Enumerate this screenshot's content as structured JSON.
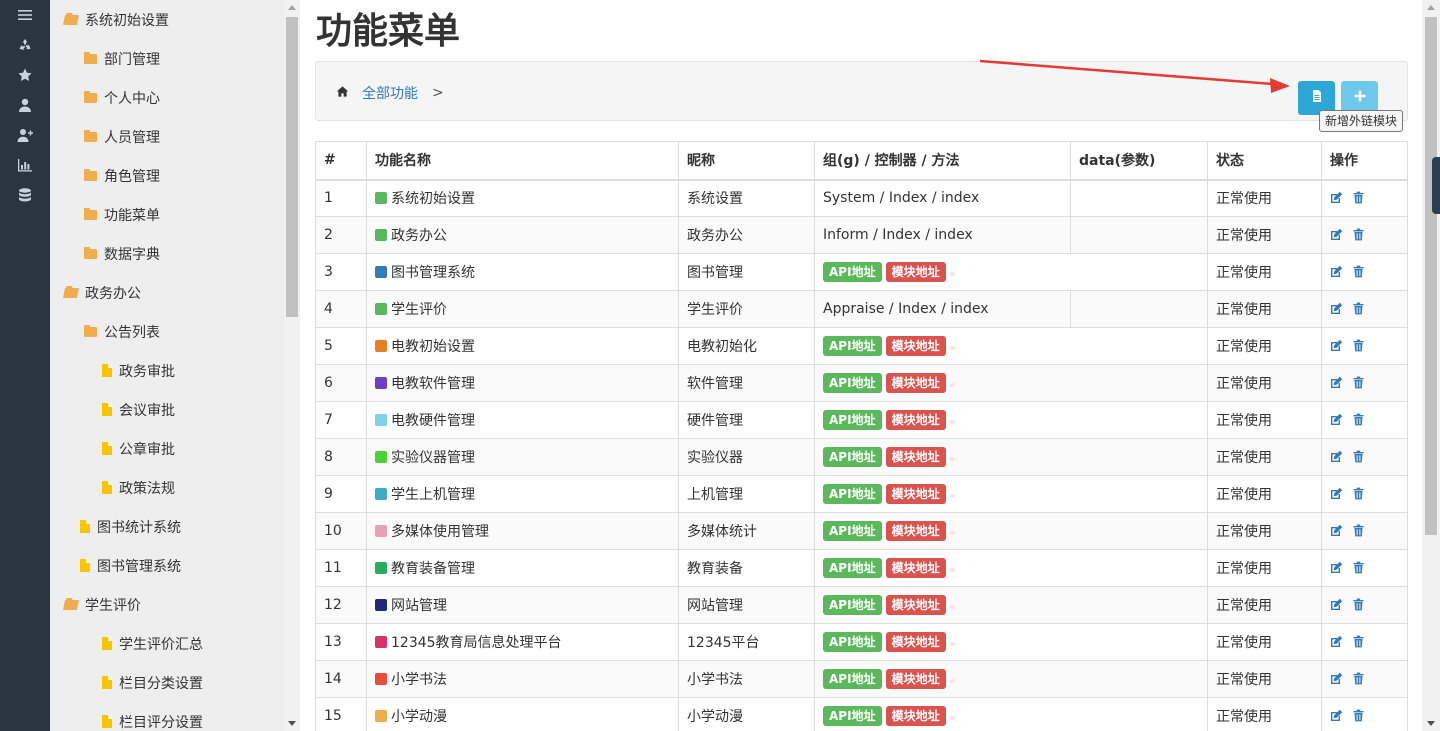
{
  "rail_icons": [
    "menu-icon",
    "recycle-icon",
    "star-icon",
    "user-icon",
    "add-user-icon",
    "bar-chart-icon",
    "database-icon"
  ],
  "tree": [
    {
      "label": "系统初始设置",
      "icon": "folder-open",
      "level": 0
    },
    {
      "label": "部门管理",
      "icon": "folder",
      "level": 1
    },
    {
      "label": "个人中心",
      "icon": "folder",
      "level": 1
    },
    {
      "label": "人员管理",
      "icon": "folder",
      "level": 1
    },
    {
      "label": "角色管理",
      "icon": "folder",
      "level": 1
    },
    {
      "label": "功能菜单",
      "icon": "folder",
      "level": 1
    },
    {
      "label": "数据字典",
      "icon": "folder",
      "level": 1
    },
    {
      "label": "政务办公",
      "icon": "folder-open",
      "level": 0
    },
    {
      "label": "公告列表",
      "icon": "folder",
      "level": 1
    },
    {
      "label": "政务审批",
      "icon": "file",
      "level": 2
    },
    {
      "label": "会议审批",
      "icon": "file",
      "level": 2
    },
    {
      "label": "公章审批",
      "icon": "file",
      "level": 2
    },
    {
      "label": "政策法规",
      "icon": "file",
      "level": 2
    },
    {
      "label": "图书统计系统",
      "icon": "file",
      "level": 1
    },
    {
      "label": "图书管理系统",
      "icon": "file",
      "level": 1
    },
    {
      "label": "学生评价",
      "icon": "folder-open",
      "level": 0
    },
    {
      "label": "学生评价汇总",
      "icon": "file",
      "level": 2
    },
    {
      "label": "栏目分类设置",
      "icon": "file",
      "level": 2
    },
    {
      "label": "栏目评分设置",
      "icon": "file",
      "level": 2
    }
  ],
  "page_title": "功能菜单",
  "breadcrumb": {
    "root": "全部功能",
    "separator": ">"
  },
  "toolbar": {
    "tooltip": "新增外链模块",
    "add_link_icon": "file-text-icon",
    "add_icon": "plus-icon"
  },
  "table": {
    "headers": [
      "#",
      "功能名称",
      "昵称",
      "组(g) / 控制器 / 方法",
      "data(参数)",
      "状态",
      "操作"
    ],
    "api_label": "API地址",
    "module_label": "模块地址",
    "rows": [
      {
        "num": "1",
        "name": "系统初始设置",
        "nick": "系统设置",
        "route": "System / Index / index",
        "status": "正常使用",
        "icon_color": "#5cb85c",
        "icon": "refresh-icon"
      },
      {
        "num": "2",
        "name": "政务办公",
        "nick": "政务办公",
        "route": "Inform / Index / index",
        "status": "正常使用",
        "icon_color": "#5cb85c",
        "icon": "bullhorn-icon"
      },
      {
        "num": "3",
        "name": "图书管理系统",
        "nick": "图书管理",
        "route": "",
        "status": "正常使用",
        "icon_color": "#337ab7",
        "icon": "book-icon"
      },
      {
        "num": "4",
        "name": "学生评价",
        "nick": "学生评价",
        "route": "Appraise / Index / index",
        "status": "正常使用",
        "icon_color": "#5cb85c",
        "icon": "edit-icon"
      },
      {
        "num": "5",
        "name": "电教初始设置",
        "nick": "电教初始化",
        "route": "",
        "status": "正常使用",
        "icon_color": "#e67e22",
        "icon": "clock-icon"
      },
      {
        "num": "6",
        "name": "电教软件管理",
        "nick": "软件管理",
        "route": "",
        "status": "正常使用",
        "icon_color": "#6c3fc5",
        "icon": "pencil-icon"
      },
      {
        "num": "7",
        "name": "电教硬件管理",
        "nick": "硬件管理",
        "route": "",
        "status": "正常使用",
        "icon_color": "#7fd3e8",
        "icon": "gears-icon"
      },
      {
        "num": "8",
        "name": "实验仪器管理",
        "nick": "实验仪器",
        "route": "",
        "status": "正常使用",
        "icon_color": "#4cd137",
        "icon": "glass-icon"
      },
      {
        "num": "9",
        "name": "学生上机管理",
        "nick": "上机管理",
        "route": "",
        "status": "正常使用",
        "icon_color": "#3fa9c9",
        "icon": "laptop-icon"
      },
      {
        "num": "10",
        "name": "多媒体使用管理",
        "nick": "多媒体统计",
        "route": "",
        "status": "正常使用",
        "icon_color": "#e8a0b4",
        "icon": "picture-icon"
      },
      {
        "num": "11",
        "name": "教育装备管理",
        "nick": "教育装备",
        "route": "",
        "status": "正常使用",
        "icon_color": "#27ae60",
        "icon": "briefcase-icon"
      },
      {
        "num": "12",
        "name": "网站管理",
        "nick": "网站管理",
        "route": "",
        "status": "正常使用",
        "icon_color": "#1e2a78",
        "icon": "desktop-icon"
      },
      {
        "num": "13",
        "name": "12345教育局信息处理平台",
        "nick": "12345平台",
        "route": "",
        "status": "正常使用",
        "icon_color": "#d6336c",
        "icon": "picture-icon"
      },
      {
        "num": "14",
        "name": "小学书法",
        "nick": "小学书法",
        "route": "",
        "status": "正常使用",
        "icon_color": "#e74c3c",
        "icon": "brush-icon"
      },
      {
        "num": "15",
        "name": "小学动漫",
        "nick": "小学动漫",
        "route": "",
        "status": "正常使用",
        "icon_color": "#f0ad4e",
        "icon": "cube-icon"
      }
    ]
  },
  "colors": {
    "rail_bg": "#2a3542",
    "sidebar_bg": "#eeeeee",
    "link": "#337ab7",
    "success": "#5cb85c",
    "danger": "#d9534f",
    "info": "#3bb4e0",
    "annotation_arrow": "#e53935"
  }
}
